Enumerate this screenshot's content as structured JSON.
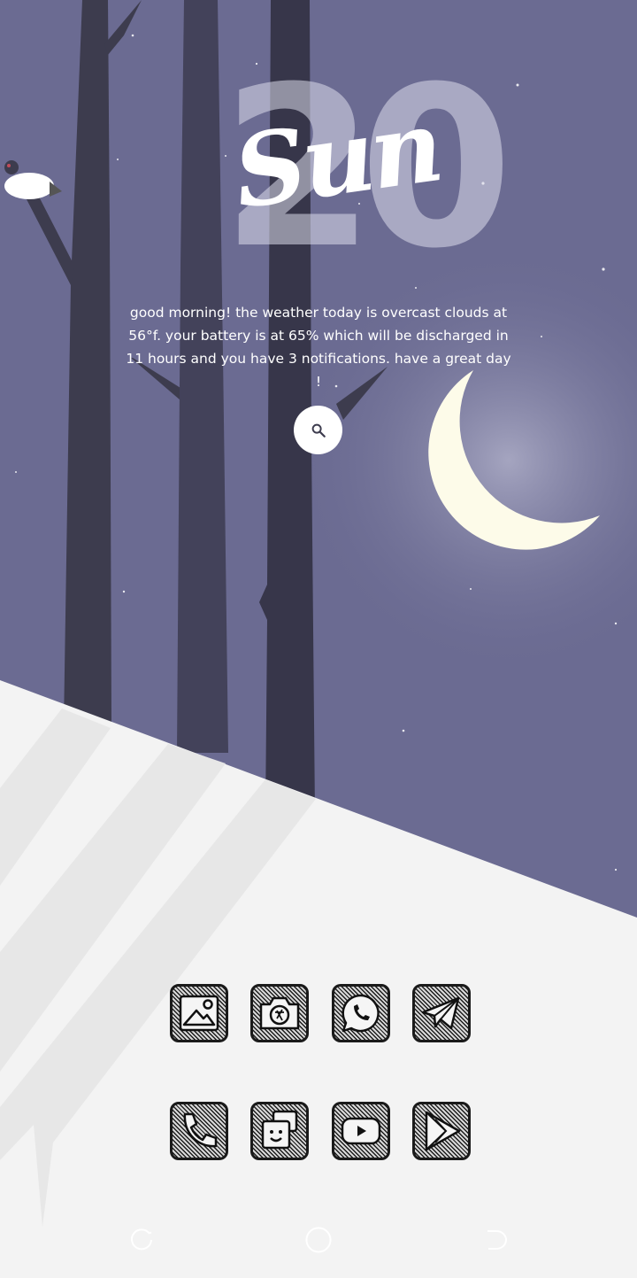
{
  "home": {
    "date_number": "20",
    "day_name": "Sun",
    "greeting": "good morning! the weather today is overcast clouds at 56°f. your battery is at 65% which will be discharged in 11 hours and you have 3 notifications. have a great day !"
  },
  "colors": {
    "sky": "#6b6b92",
    "snow": "#f3f3f3",
    "moon": "#fdfbe9",
    "trunk": "#3d3c4e"
  },
  "icons": {
    "search": "search-icon",
    "dock_row_1": [
      "gallery-icon",
      "camera-icon",
      "whatsapp-icon",
      "telegram-icon"
    ],
    "dock_row_2": [
      "phone-icon",
      "messages-icon",
      "youtube-icon",
      "play-store-icon"
    ],
    "nav": [
      "recents-icon",
      "home-icon",
      "back-icon"
    ]
  }
}
